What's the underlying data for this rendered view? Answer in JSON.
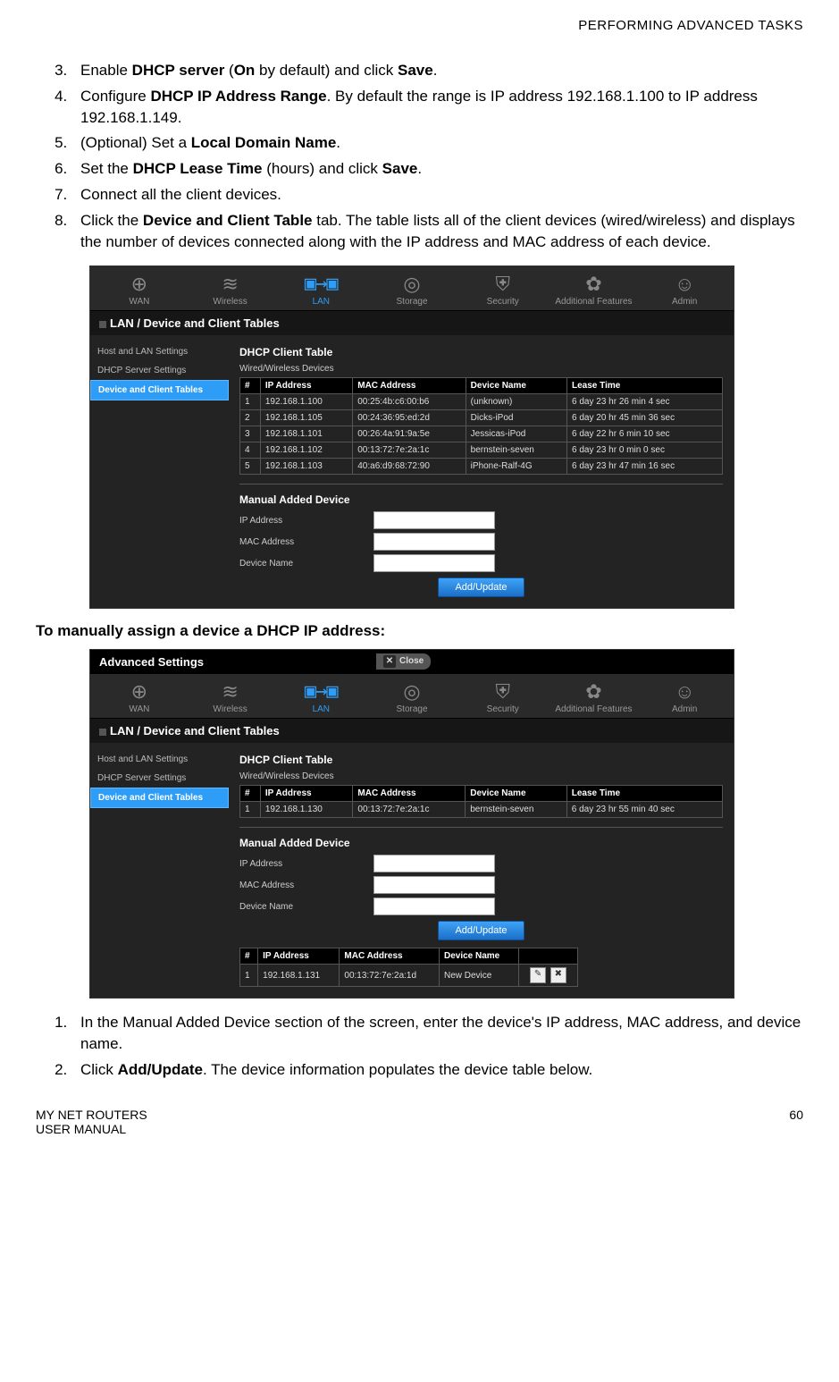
{
  "header": {
    "title": "PERFORMING ADVANCED TASKS"
  },
  "steps_a": [
    {
      "n": "3.",
      "pre": "Enable ",
      "b1": "DHCP server",
      "mid": " (",
      "b2": "On",
      "mid2": " by default) and click ",
      "b3": "Save",
      "post": "."
    },
    {
      "n": "4.",
      "pre": "Configure ",
      "b1": "DHCP IP Address Range",
      "post": ". By default the range is IP address 192.168.1.100 to IP address 192.168.1.149."
    },
    {
      "n": "5.",
      "pre": "(Optional) Set a ",
      "b1": "Local Domain Name",
      "post": "."
    },
    {
      "n": "6.",
      "pre": "Set the ",
      "b1": "DHCP Lease Time",
      "mid": " (hours) and click ",
      "b2": "Save",
      "post": "."
    },
    {
      "n": "7.",
      "pre": "Connect all the client devices."
    },
    {
      "n": "8.",
      "pre": "Click the ",
      "b1": "Device and Client Table",
      "post": " tab. The table lists all of the client devices (wired/wireless) and displays the number of devices connected along with the IP address and MAC address of each device."
    }
  ],
  "subhead1": "To manually assign a device a DHCP IP address",
  "steps_b": [
    {
      "n": "1.",
      "pre": "In the Manual Added Device section of the screen, enter the device's IP address, MAC address, and device name."
    },
    {
      "n": "2.",
      "pre": "Click ",
      "b1": "Add/Update",
      "post": ". The device information populates the device table below."
    }
  ],
  "footer": {
    "left1": "MY NET ROUTERS",
    "left2": "USER MANUAL",
    "page": "60"
  },
  "ui": {
    "advanced": "Advanced Settings",
    "close": "Close",
    "nav": {
      "wan": "WAN",
      "wireless": "Wireless",
      "lan": "LAN",
      "storage": "Storage",
      "security": "Security",
      "addl": "Additional Features",
      "admin": "Admin"
    },
    "breadcrumb": "LAN / Device and Client Tables",
    "side": {
      "host": "Host and LAN Settings",
      "dhcp": "DHCP Server Settings",
      "tables": "Device and Client Tables"
    },
    "sec1": "DHCP Client Table",
    "sub1": "Wired/Wireless Devices",
    "th": {
      "n": "#",
      "ip": "IP Address",
      "mac": "MAC Address",
      "dev": "Device Name",
      "lease": "Lease Time"
    },
    "rows1": [
      {
        "n": "1",
        "ip": "192.168.1.100",
        "mac": "00:25:4b:c6:00:b6",
        "dev": "(unknown)",
        "lease": "6 day 23 hr 26 min 4 sec"
      },
      {
        "n": "2",
        "ip": "192.168.1.105",
        "mac": "00:24:36:95:ed:2d",
        "dev": "Dicks-iPod",
        "lease": "6 day 20 hr 45 min 36 sec"
      },
      {
        "n": "3",
        "ip": "192.168.1.101",
        "mac": "00:26:4a:91:9a:5e",
        "dev": "Jessicas-iPod",
        "lease": "6 day 22 hr 6 min 10 sec"
      },
      {
        "n": "4",
        "ip": "192.168.1.102",
        "mac": "00:13:72:7e:2a:1c",
        "dev": "bernstein-seven",
        "lease": "6 day 23 hr 0 min 0 sec"
      },
      {
        "n": "5",
        "ip": "192.168.1.103",
        "mac": "40:a6:d9:68:72:90",
        "dev": "iPhone-Ralf-4G",
        "lease": "6 day 23 hr 47 min 16 sec"
      }
    ],
    "rows2": [
      {
        "n": "1",
        "ip": "192.168.1.130",
        "mac": "00:13:72:7e:2a:1c",
        "dev": "bernstein-seven",
        "lease": "6 day 23 hr 55 min 40 sec"
      }
    ],
    "rows3": [
      {
        "n": "1",
        "ip": "192.168.1.131",
        "mac": "00:13:72:7e:2a:1d",
        "dev": "New Device"
      }
    ],
    "sec2": "Manual Added Device",
    "form": {
      "ip": "IP Address",
      "mac": "MAC Address",
      "dev": "Device Name"
    },
    "btn": "Add/Update"
  }
}
